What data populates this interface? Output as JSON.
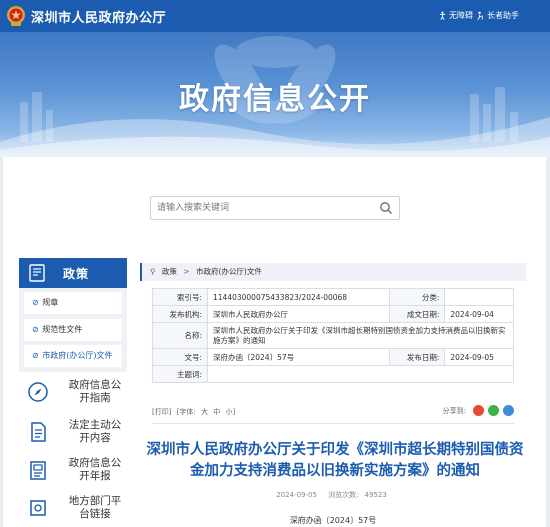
{
  "header": {
    "site_name": "深圳市人民政府办公厅",
    "links": [
      {
        "label": "无障碍",
        "icon": "accessibility-icon"
      },
      {
        "label": "长者助手",
        "icon": "elder-assistant-icon"
      }
    ]
  },
  "banner": {
    "title": "政府信息公开"
  },
  "search": {
    "placeholder": "请输入搜索关键词"
  },
  "sidebar": {
    "section_title": "政策",
    "sub_items": [
      {
        "label": "规章"
      },
      {
        "label": "规范性文件"
      },
      {
        "label": "市政府(办公厅)文件",
        "active": true
      }
    ],
    "links": [
      {
        "label": "政府信息公开指南",
        "icon": "compass-icon"
      },
      {
        "label": "法定主动公开内容",
        "icon": "document-icon"
      },
      {
        "label": "政府信息公开年报",
        "icon": "report-icon"
      },
      {
        "label": "地方部门平台链接",
        "icon": "link-icon"
      }
    ]
  },
  "breadcrumb": {
    "items": [
      "政策",
      "市政府(办公厅)文件"
    ]
  },
  "meta": {
    "index_no_label": "索引号:",
    "index_no": "11440300007543382 3/2024-00068",
    "category_label": "分类:",
    "category": "",
    "issuer_label": "发布机构:",
    "issuer": "深圳市人民政府办公厅",
    "date_label": "成文日期:",
    "date": "2024-09-04",
    "name_label": "名称:",
    "name": "深圳市人民政府办公厅关于印发《深圳市超长期特别国债资金加力支持消费品以旧换新实施方案》的通知",
    "docno_label": "文号:",
    "docno": "深府办函〔2024〕57号",
    "pubdate_label": "发布日期:",
    "pubdate": "2024-09-05",
    "keywords_label": "主题词:",
    "keywords": ""
  },
  "tools": {
    "print": "[打印]",
    "font_label": "[字体:",
    "size_large": "大",
    "size_medium": "中",
    "size_small": "小]",
    "share_label": "分享到:"
  },
  "article": {
    "title": "深圳市人民政府办公厅关于印发《深圳市超长期特别国债资金加力支持消费品以旧换新实施方案》的通知",
    "date": "2024-09-05",
    "views_label": "浏览次数:",
    "views": "49523",
    "doc_no": "深府办函〔2024〕57号"
  },
  "colors": {
    "primary": "#1c5cb0",
    "banner": "#5b93d6"
  }
}
